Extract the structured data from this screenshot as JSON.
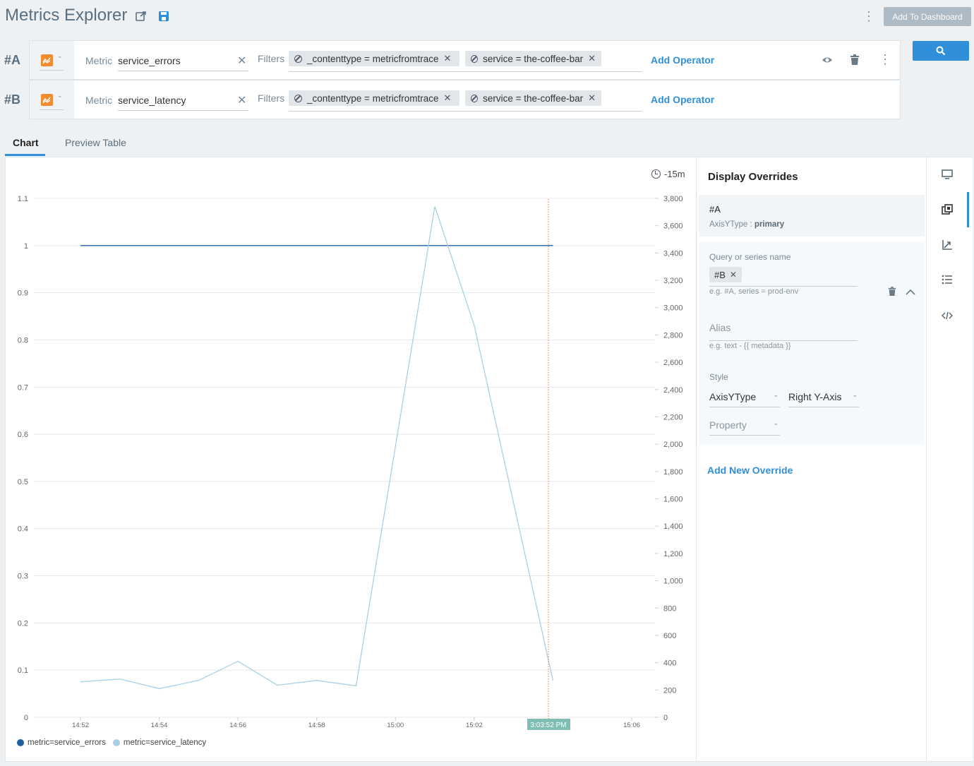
{
  "header": {
    "title": "Metrics Explorer",
    "add_to_dashboard": "Add To Dashboard"
  },
  "queries": [
    {
      "label": "#A",
      "metric_label": "Metric",
      "metric_value": "service_errors",
      "filters_label": "Filters",
      "filters": [
        "_contenttype = metricfromtrace",
        "service = the-coffee-bar"
      ],
      "add_operator": "Add Operator"
    },
    {
      "label": "#B",
      "metric_label": "Metric",
      "metric_value": "service_latency",
      "filters_label": "Filters",
      "filters": [
        "_contenttype = metricfromtrace",
        "service = the-coffee-bar"
      ],
      "add_operator": "Add Operator"
    }
  ],
  "tabs": [
    "Chart",
    "Preview Table"
  ],
  "chart": {
    "time_range": "-15m",
    "cursor_label": "3:03:52 PM",
    "legend": [
      "metric=service_errors",
      "metric=service_latency"
    ]
  },
  "chart_data": {
    "type": "line",
    "x_ticks": [
      "14:52",
      "14:54",
      "14:56",
      "14:58",
      "15:00",
      "15:02",
      "15:06"
    ],
    "left_axis": {
      "ticks": [
        "0",
        "0.1",
        "0.2",
        "0.3",
        "0.4",
        "0.5",
        "0.6",
        "0.7",
        "0.8",
        "0.9",
        "1",
        "1.1"
      ],
      "ylim": [
        0,
        1.1
      ]
    },
    "right_axis": {
      "ticks": [
        "0",
        "200",
        "400",
        "600",
        "800",
        "1,000",
        "1,200",
        "1,400",
        "1,600",
        "1,800",
        "2,000",
        "2,200",
        "2,400",
        "2,600",
        "2,800",
        "3,000",
        "3,200",
        "3,400",
        "3,600",
        "3,800"
      ],
      "ylim": [
        0,
        3800
      ]
    },
    "series": [
      {
        "name": "metric=service_errors",
        "axis": "left",
        "color": "#1f5f9e",
        "x": [
          "14:52",
          "15:04"
        ],
        "values": [
          1,
          1
        ]
      },
      {
        "name": "metric=service_latency",
        "axis": "right",
        "color": "#a8cfe6",
        "x": [
          "14:52",
          "14:53",
          "14:54",
          "14:55",
          "14:56",
          "14:57",
          "14:58",
          "14:59",
          "15:01",
          "15:02",
          "15:04"
        ],
        "values": [
          260,
          280,
          210,
          270,
          410,
          235,
          270,
          230,
          3740,
          2870,
          270
        ]
      }
    ],
    "grid": true,
    "legend_position": "bottom-left"
  },
  "overrides": {
    "title": "Display Overrides",
    "item_a": {
      "name": "#A",
      "axis_label": "AxisYType :",
      "axis_value": "primary"
    },
    "query_label": "Query or series name",
    "query_chip": "#B",
    "query_hint": "e.g. #A, series = prod-env",
    "alias_placeholder": "Alias",
    "alias_hint": "e.g. text - {{ metadata }}",
    "style_label": "Style",
    "style_select": "AxisYType",
    "style_value": "Right Y-Axis",
    "property_placeholder": "Property",
    "add_new": "Add New Override"
  },
  "colors": {
    "accent": "#2f8fd8",
    "series_a": "#1f5f9e",
    "series_b": "#a8cfe6",
    "cursor": "#e07a3a"
  }
}
